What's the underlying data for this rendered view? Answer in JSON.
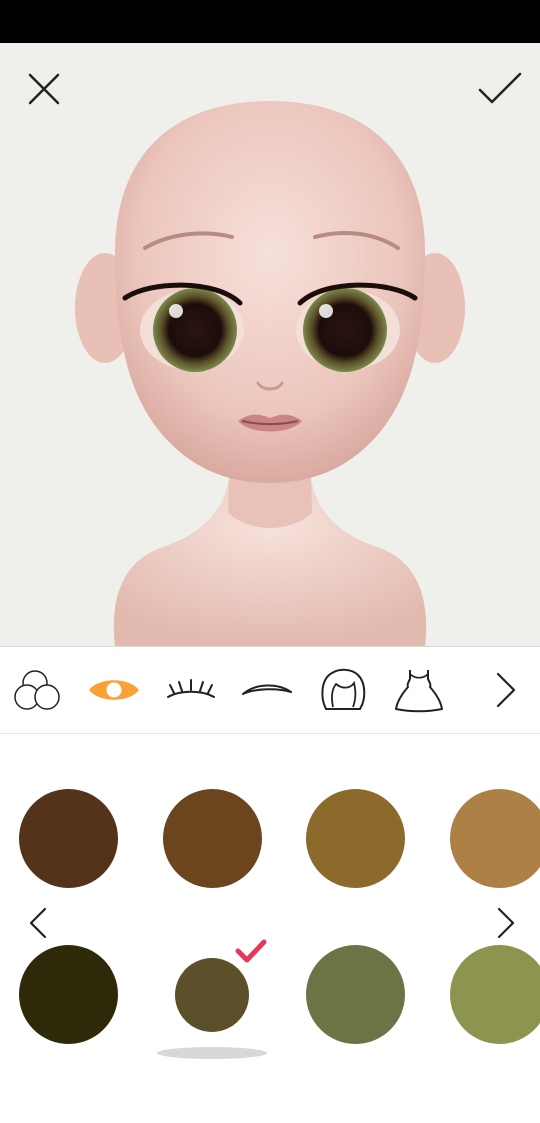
{
  "app": {
    "screen": "eye-color-editor"
  },
  "header": {
    "close_icon": "close-icon",
    "confirm_icon": "checkmark-icon"
  },
  "toolbar": {
    "items": [
      {
        "name": "skin-tone-tool",
        "icon": "color-circles-icon",
        "selected": false
      },
      {
        "name": "eye-color-tool",
        "icon": "eye-icon",
        "selected": true,
        "accent": "#f7a136"
      },
      {
        "name": "eyelashes-tool",
        "icon": "eyelashes-icon",
        "selected": false
      },
      {
        "name": "eyebrows-tool",
        "icon": "eyebrow-icon",
        "selected": false
      },
      {
        "name": "hair-tool",
        "icon": "hair-icon",
        "selected": false
      },
      {
        "name": "dress-tool",
        "icon": "dress-icon",
        "selected": false
      }
    ],
    "next_icon": "chevron-right-icon"
  },
  "palette": {
    "row1": [
      "#55331a",
      "#6a451d",
      "#8b6a2c",
      "#ad8146"
    ],
    "row2": [
      "#2e2a09",
      "#5b502a",
      "#6a7444",
      "#8c944f"
    ],
    "selected_index": 5,
    "selected_mark_color": "#e8375a",
    "prev_icon": "chevron-left-icon",
    "next_icon": "chevron-right-icon"
  }
}
